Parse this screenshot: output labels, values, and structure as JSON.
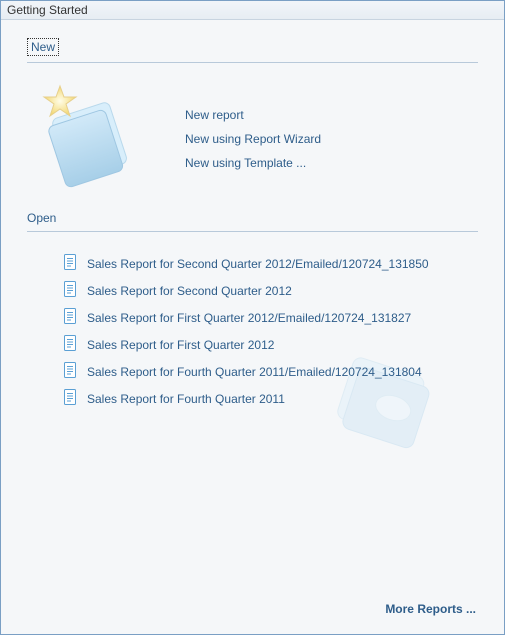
{
  "panel_title": "Getting Started",
  "new_section": {
    "label": "New",
    "actions": {
      "new_report": "New report",
      "new_wizard": "New using Report Wizard",
      "new_template": "New using Template ..."
    }
  },
  "open_section": {
    "label": "Open",
    "items": [
      "Sales Report for Second Quarter 2012/Emailed/120724_131850",
      "Sales Report for Second Quarter 2012",
      "Sales Report for First Quarter 2012/Emailed/120724_131827",
      "Sales Report for First Quarter 2012",
      "Sales Report for Fourth Quarter 2011/Emailed/120724_131804",
      "Sales Report for Fourth Quarter 2011"
    ]
  },
  "more_reports_label": "More Reports ..."
}
